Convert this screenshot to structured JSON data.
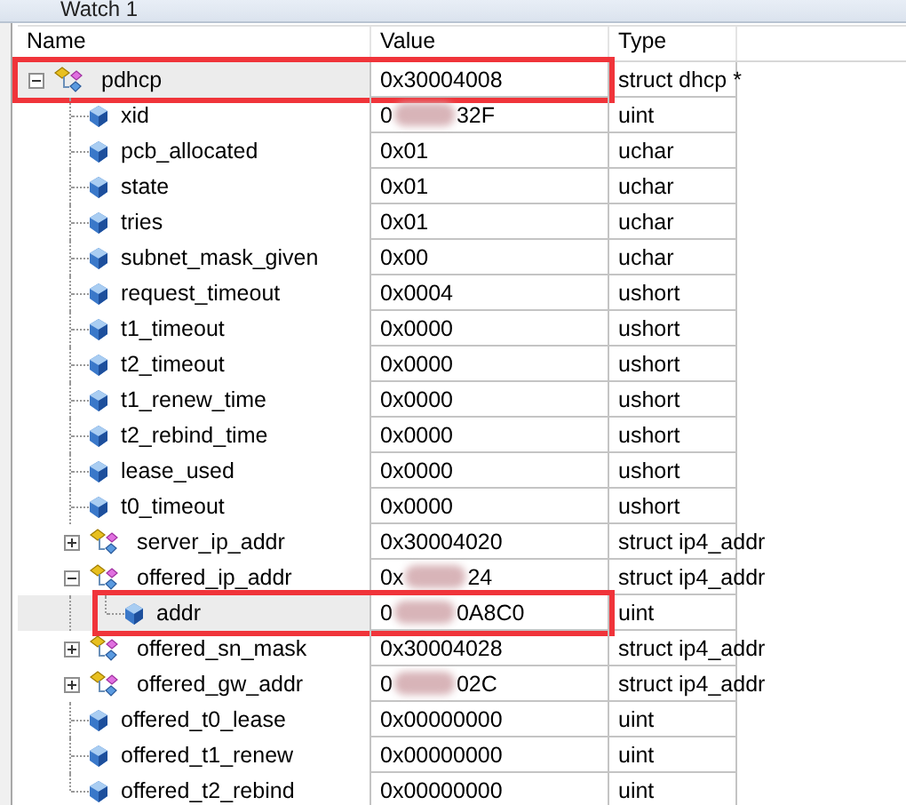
{
  "window": {
    "title": "Watch 1"
  },
  "columns": [
    "Name",
    "Value",
    "Type"
  ],
  "rows": [
    {
      "kind": "struct",
      "name": "pdhcp",
      "value": "0x30004008",
      "type": "struct dhcp *",
      "expanded": true,
      "selected": true,
      "annotated": true,
      "children": [
        {
          "kind": "field",
          "name": "xid",
          "value_start": "0",
          "value_end": "32F",
          "redacted": true,
          "type": "uint"
        },
        {
          "kind": "field",
          "name": "pcb_allocated",
          "value": "0x01",
          "type": "uchar"
        },
        {
          "kind": "field",
          "name": "state",
          "value": "0x01",
          "type": "uchar"
        },
        {
          "kind": "field",
          "name": "tries",
          "value": "0x01",
          "type": "uchar"
        },
        {
          "kind": "field",
          "name": "subnet_mask_given",
          "value": "0x00",
          "type": "uchar"
        },
        {
          "kind": "field",
          "name": "request_timeout",
          "value": "0x0004",
          "type": "ushort"
        },
        {
          "kind": "field",
          "name": "t1_timeout",
          "value": "0x0000",
          "type": "ushort"
        },
        {
          "kind": "field",
          "name": "t2_timeout",
          "value": "0x0000",
          "type": "ushort"
        },
        {
          "kind": "field",
          "name": "t1_renew_time",
          "value": "0x0000",
          "type": "ushort"
        },
        {
          "kind": "field",
          "name": "t2_rebind_time",
          "value": "0x0000",
          "type": "ushort"
        },
        {
          "kind": "field",
          "name": "lease_used",
          "value": "0x0000",
          "type": "ushort"
        },
        {
          "kind": "field",
          "name": "t0_timeout",
          "value": "0x0000",
          "type": "ushort"
        },
        {
          "kind": "struct",
          "name": "server_ip_addr",
          "value": "0x30004020",
          "type": "struct ip4_addr",
          "expanded": false
        },
        {
          "kind": "struct",
          "name": "offered_ip_addr",
          "value_start": "0x",
          "value_end": "24",
          "redacted": true,
          "type": "struct ip4_addr",
          "expanded": true,
          "children": [
            {
              "kind": "field",
              "name": "addr",
              "value_start": "0",
              "value_end": "0A8C0",
              "redacted": true,
              "type": "uint",
              "selected": true,
              "annotated": true
            }
          ]
        },
        {
          "kind": "struct",
          "name": "offered_sn_mask",
          "value": "0x30004028",
          "type": "struct ip4_addr",
          "expanded": false
        },
        {
          "kind": "struct",
          "name": "offered_gw_addr",
          "value_start": "0",
          "value_end": "02C",
          "redacted": true,
          "type": "struct ip4_addr",
          "expanded": false
        },
        {
          "kind": "field",
          "name": "offered_t0_lease",
          "value": "0x00000000",
          "type": "uint"
        },
        {
          "kind": "field",
          "name": "offered_t1_renew",
          "value": "0x00000000",
          "type": "uint"
        },
        {
          "kind": "field",
          "name": "offered_t2_rebind",
          "value": "0x00000000",
          "type": "uint"
        }
      ]
    }
  ]
}
